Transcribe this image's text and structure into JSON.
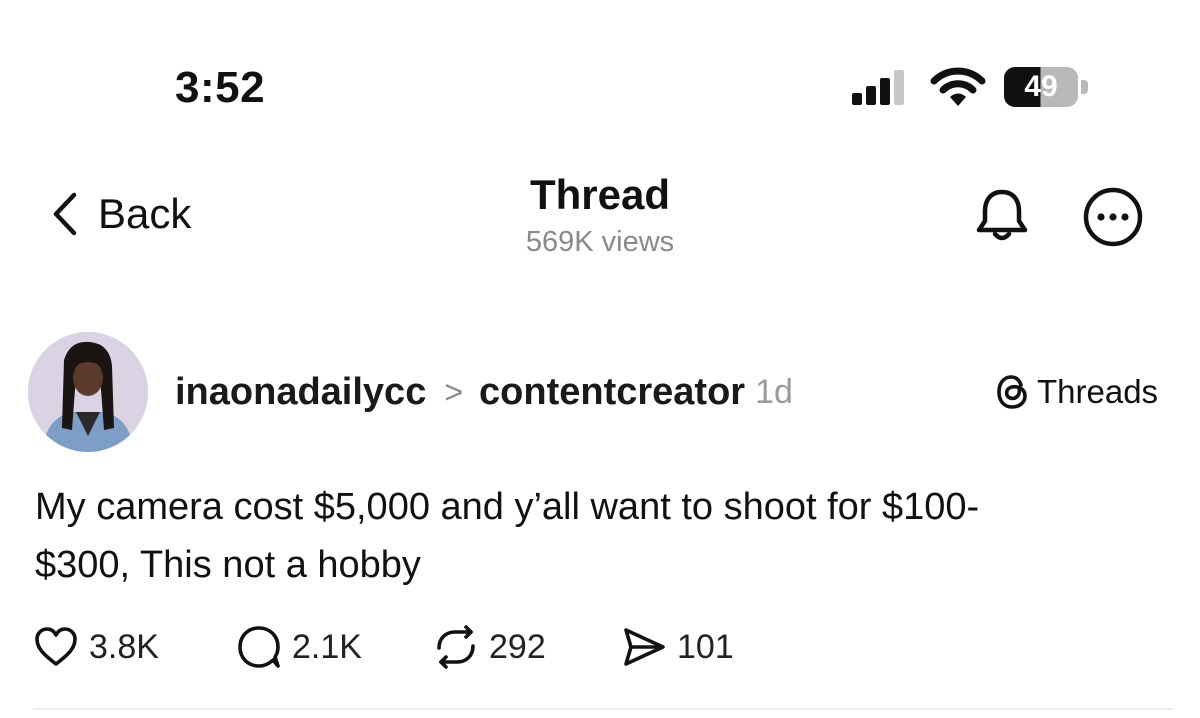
{
  "status_bar": {
    "time": "3:52",
    "battery": "49"
  },
  "nav": {
    "back_label": "Back",
    "title": "Thread",
    "views": "569K views"
  },
  "post": {
    "username": "inaonadailycc",
    "separator": ">",
    "community": "contentcreator",
    "age": "1d",
    "source_badge": "Threads",
    "text": "My camera cost $5,000 and y’all want to shoot for $100-\n$300, This not a hobby",
    "actions": {
      "likes": "3.8K",
      "replies": "2.1K",
      "reposts": "292",
      "shares": "101"
    }
  },
  "icons": {
    "back": "chevron-left-icon",
    "notifications": "bell-icon",
    "more": "more-options-icon",
    "like": "heart-icon",
    "reply": "speech-bubble-icon",
    "repost": "repost-icon",
    "share": "send-icon",
    "threads_logo": "threads-logo-icon"
  },
  "colors": {
    "text": "#111111",
    "muted": "#8a8a8a",
    "background": "#ffffff"
  }
}
